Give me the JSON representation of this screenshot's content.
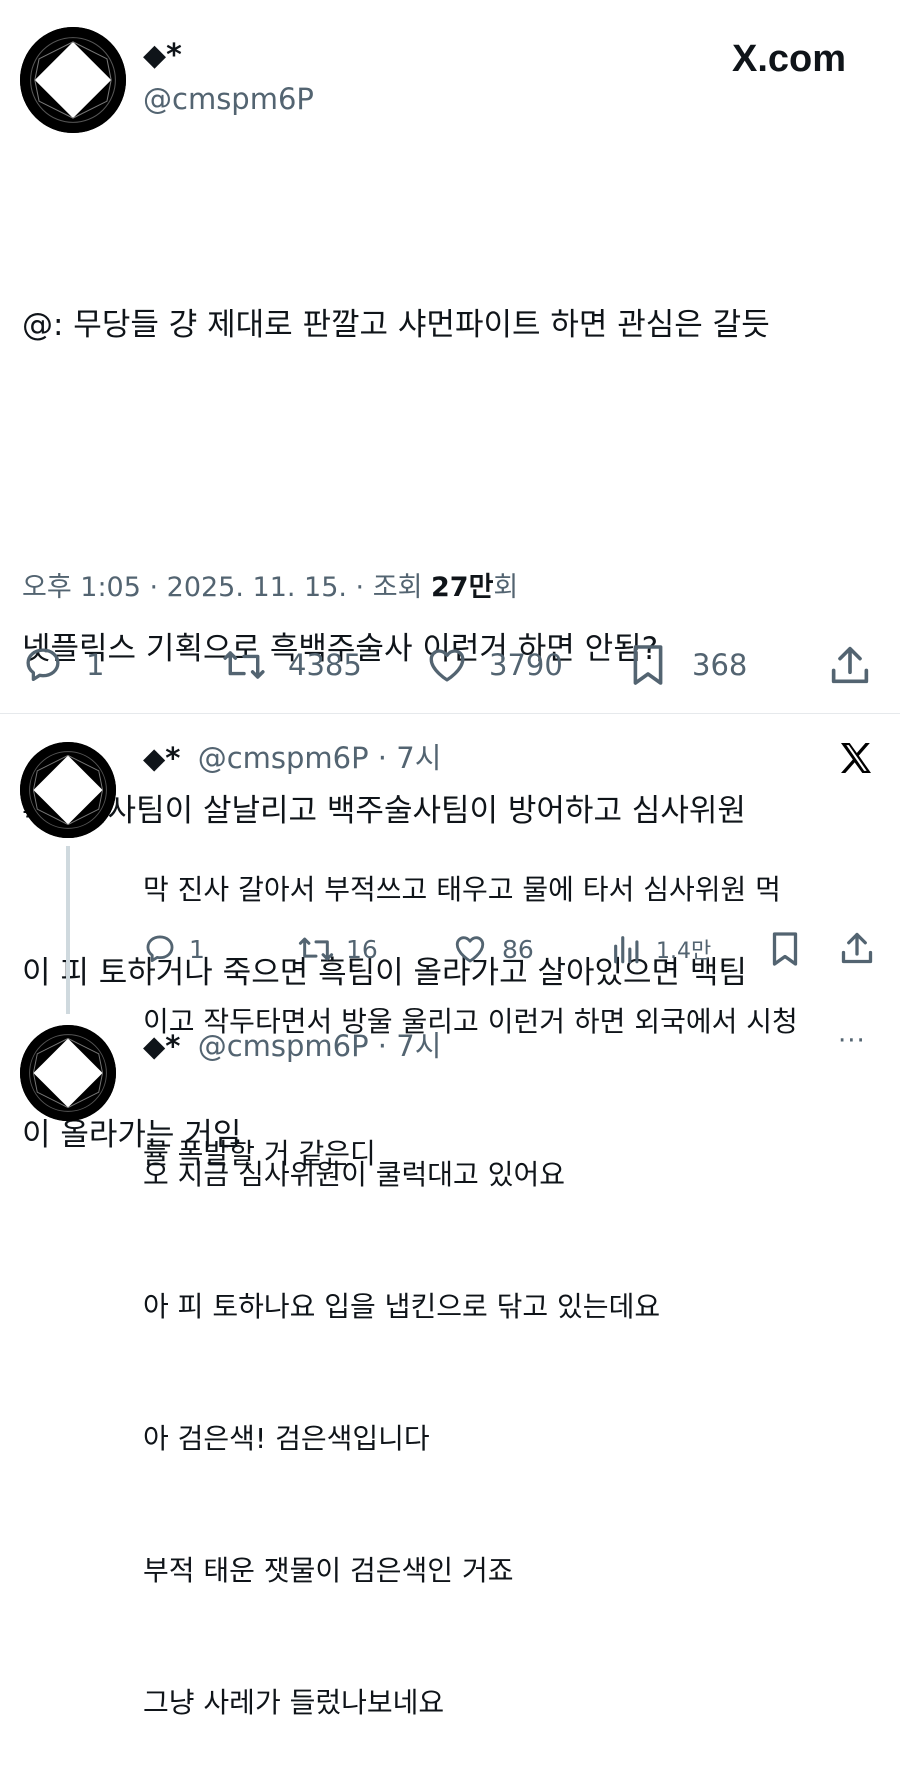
{
  "main_tweet": {
    "display_name": "◆*",
    "handle": "@cmspm6P",
    "brand": "X.com",
    "text_lines": [
      "@: 무당들 걍 제대로 판깔고 샤먼파이트 하면 관심은 갈듯",
      "",
      "넷플릭스 기획으로 흑백주술사 이런거 하면 안됨?",
      "흑주술사팀이 살날리고 백주술사팀이 방어하고 심사위원",
      "이 피 토하거나 죽으면 흑팀이 올라가고 살아있으면 백팀",
      "이 올라가는 거임"
    ],
    "timestamp": "오후 1:05 · 2025. 11. 15. · 조회 ",
    "views_bold": "27만",
    "views_suffix": "회",
    "metrics": {
      "replies": "1",
      "reposts": "4385",
      "likes": "3790",
      "bookmarks": "368"
    }
  },
  "reply1": {
    "display_name": "◆*",
    "handle_time": "@cmspm6P · 7시",
    "text_lines": [
      "막 진사 갈아서 부적쓰고 태우고 물에 타서 심사위원 먹",
      "이고 작두타면서 방울 울리고 이런거 하면 외국에서 시청",
      "률 폭발할 거 같은디"
    ],
    "metrics": {
      "replies": "1",
      "reposts": "16",
      "likes": "86",
      "views": "1.4만"
    }
  },
  "reply2": {
    "display_name": "◆*",
    "handle_time": "@cmspm6P · 7시",
    "more": "···",
    "text_lines": [
      "오 지금 심사위원이 쿨럭대고 있어요",
      "아 피 토하나요 입을 냅킨으로 닦고 있는데요",
      "아 검은색! 검은색입니다",
      "부적 태운 잿물이 검은색인 거죠",
      "그냥 사레가 들렀나보네요"
    ]
  },
  "colors": {
    "text": "#0f1419",
    "secondary": "#536471",
    "divider": "#e6e9ec",
    "thread_line": "#cfd9de"
  },
  "icons": [
    "reply-icon",
    "repost-icon",
    "like-icon",
    "bookmark-icon",
    "share-icon",
    "views-icon",
    "x-logo-icon",
    "more-icon"
  ]
}
